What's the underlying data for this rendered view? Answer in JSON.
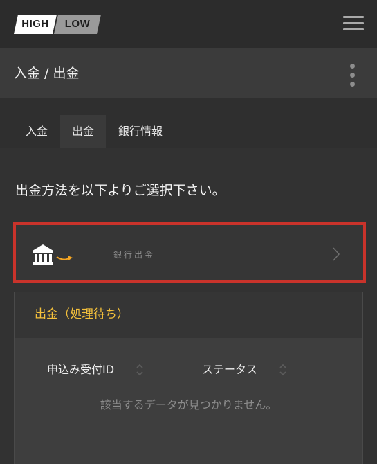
{
  "header": {
    "logo_high": "HIGH",
    "logo_low": "LOW"
  },
  "page": {
    "title": "入金 / 出金"
  },
  "tabs": [
    {
      "label": "入金",
      "active": false
    },
    {
      "label": "出金",
      "active": true
    },
    {
      "label": "銀行情報",
      "active": false
    }
  ],
  "main": {
    "instruction": "出金方法を以下よりご選択下さい。",
    "method": {
      "label": "銀行出金",
      "icon": "bank-transfer-icon"
    },
    "pending": {
      "title": "出金（処理待ち）",
      "columns": [
        "申込み受付ID",
        "ステータス"
      ],
      "empty_message": "該当するデータが見つかりません。"
    }
  },
  "colors": {
    "accent_yellow": "#f5c13b",
    "selected_border": "#c9332b",
    "background": "#323232"
  }
}
